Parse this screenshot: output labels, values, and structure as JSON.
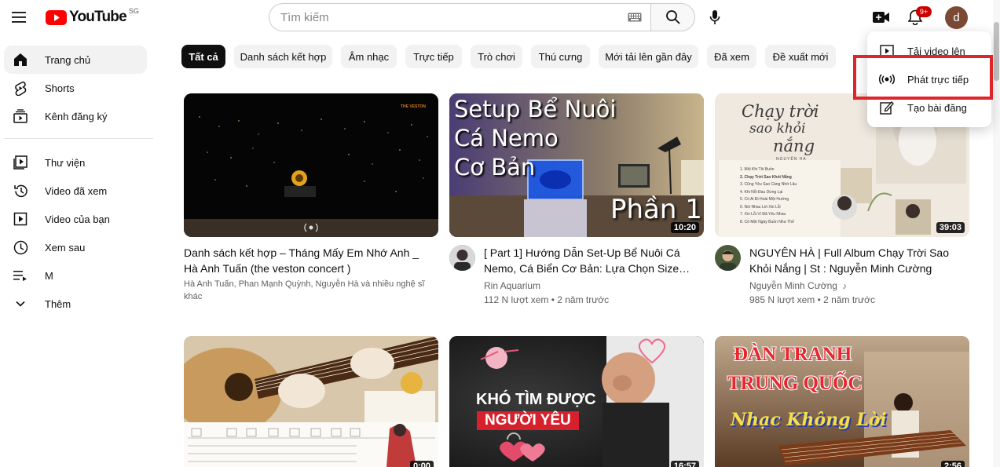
{
  "header": {
    "logo_text": "YouTube",
    "country_code": "SG",
    "search_placeholder": "Tìm kiếm",
    "notification_count": "9+",
    "avatar_letter": "d"
  },
  "sidebar": {
    "items": [
      {
        "label": "Trang chủ",
        "icon": "home-icon",
        "active": true
      },
      {
        "label": "Shorts",
        "icon": "shorts-icon"
      },
      {
        "label": "Kênh đăng ký",
        "icon": "subscriptions-icon"
      },
      {
        "label": "Thư viện",
        "icon": "library-icon"
      },
      {
        "label": "Video đã xem",
        "icon": "history-icon"
      },
      {
        "label": "Video của bạn",
        "icon": "your-videos-icon"
      },
      {
        "label": "Xem sau",
        "icon": "watch-later-icon"
      },
      {
        "label": "M",
        "icon": "playlist-icon"
      },
      {
        "label": "Thêm",
        "icon": "chevron-down-icon"
      }
    ]
  },
  "chips": [
    "Tất cả",
    "Danh sách kết hợp",
    "Âm nhạc",
    "Trực tiếp",
    "Trò chơi",
    "Thú cưng",
    "Mới tải lên gần đây",
    "Đã xem",
    "Đề xuất mới"
  ],
  "create_menu": {
    "items": [
      {
        "label": "Tải video lên",
        "icon": "upload-video-icon"
      },
      {
        "label": "Phát trực tiếp",
        "icon": "go-live-icon"
      },
      {
        "label": "Tạo bài đăng",
        "icon": "create-post-icon"
      }
    ]
  },
  "videos": [
    {
      "title_line1": "Danh sách kết hợp – Tháng Mấy Em Nhớ Anh _",
      "title_line2": "Hà Anh Tuấn (the veston concert )",
      "meta_line1": "Hà Anh Tuấn, Phan Mạnh Quỳnh, Nguyễn Hà và nhiều nghệ sĩ",
      "meta_line2": "khác",
      "thumb_watermark": "THE VESTON"
    },
    {
      "title_line1": "[ Part 1] Hướng Dẫn Set-Up Bể Nuôi Cá",
      "title_line2": "Nemo, Cá Biển Cơ Bản: Lựa Chọn Size…",
      "channel": "Rin Aquarium",
      "stats": "112 N lượt xem • 2 năm trước",
      "duration": "10:20",
      "thumb_text": [
        "Setup Bể Nuôi",
        "Cá Nemo",
        "Cơ Bản"
      ],
      "thumb_part": "Phần 1"
    },
    {
      "title_line1": "NGUYÊN HÀ | Full Album Chạy Trời Sao",
      "title_line2": "Khỏi Nắng | St : Nguyễn Minh Cường",
      "channel": "Nguyễn Minh Cường",
      "channel_badge": "♪",
      "stats": "985 N lượt xem • 2 năm trước",
      "duration": "39:03",
      "thumb_script": [
        "Chạy trời",
        "sao khỏi",
        "nắng"
      ],
      "thumb_artist": "NGUYÊN HÀ",
      "thumb_tracks": [
        "1. Mối Khi Tôi Buồn",
        "2. Chạy Trời Sao Khỏi Nắng",
        "3. Cũng Yêu Sao Càng Nhớ Lâu",
        "4. Khi Nỗi Đau Dừng Lại",
        "5. Có Ai Đi Hoài Một Hướng",
        "6. Nói Nhau Lời Xin Lỗi",
        "7. Xin Lỗi Vì Đã Yêu Nhau",
        "8. Cô Một Ngày Buồn Như Thế"
      ]
    },
    {
      "duration": "0:00"
    },
    {
      "thumb_line1": "KHÓ TÌM ĐƯỢC",
      "thumb_line2": "NGƯỜI YÊU",
      "duration": "16:57"
    },
    {
      "thumb_line1": "ĐÀN TRANH",
      "thumb_line2": "TRUNG QUỐC",
      "thumb_line3": "Nhạc Không Lời",
      "duration": "2:56"
    }
  ]
}
